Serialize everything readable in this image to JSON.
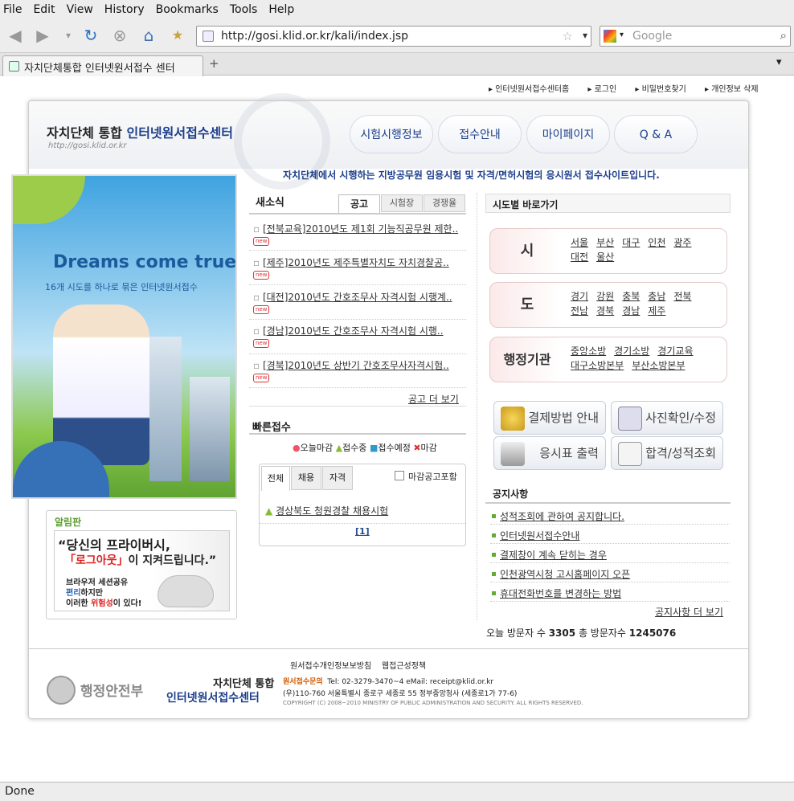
{
  "browser": {
    "menu": [
      "File",
      "Edit",
      "View",
      "History",
      "Bookmarks",
      "Tools",
      "Help"
    ],
    "url": "http://gosi.klid.or.kr/kali/index.jsp",
    "search_placeholder": "Google",
    "tab_title": "자치단체통합 인터넷원서접수 센터",
    "status": "Done"
  },
  "toplinks": [
    "인터넷원서접수센터홈",
    "로그인",
    "비밀번호찾기",
    "개인정보 삭제"
  ],
  "header": {
    "title_a": "자치단체 통합",
    "title_b": "인터넷원서접수센터",
    "url": "http://gosi.klid.or.kr",
    "nav": [
      "시험시행정보",
      "접수안내",
      "마이페이지",
      "Q & A"
    ],
    "tagline": "자치단체에서 시행하는 지방공무원 임용시험 및 자격/면허시험의 응시원서 접수사이트입니다."
  },
  "banner": {
    "headline": "Dreams come true!",
    "sub": "16개 시도를 하나로 묶은 인터넷원서접수"
  },
  "notice_board": {
    "title": "알림판",
    "quote1": "당신의 프라이버시,",
    "quote2a": "「로그아웃」",
    "quote2b": "이 지켜드립니다.",
    "body1": "브라우저 세션공유",
    "body2a": "편리",
    "body2b": "하지만",
    "body3a": "이러한 ",
    "body3b": "위험성",
    "body3c": "이 있다!"
  },
  "news": {
    "title": "새소식",
    "tabs": [
      "공고",
      "시험장",
      "경쟁율"
    ],
    "items": [
      "[전북교육]2010년도 제1회 기능직공무원 제한..",
      "[제주]2010년도 제주특별자치도 자치경찰공..",
      "[대전]2010년도 간호조무사 자격시험 시행계..",
      "[경남]2010년도 간호조무사 자격시험 시행..",
      "[경북]2010년도 상반기 간호조무사자격시험.."
    ],
    "new_label": "new",
    "more": "공고 더 보기"
  },
  "quick": {
    "title": "빠른접수",
    "legend": [
      "오늘마감",
      "접수중",
      "접수예정",
      "마감"
    ],
    "tabs": [
      "전체",
      "채용",
      "자격"
    ],
    "checkbox": "마감공고포함",
    "item": "경상북도 청원경찰 채용시험",
    "page": "[1]"
  },
  "regions": {
    "title": "시도별 바로가기",
    "groups": [
      {
        "label": "시",
        "cities": [
          "서울",
          "부산",
          "대구",
          "인천",
          "광주",
          "대전",
          "울산"
        ]
      },
      {
        "label": "도",
        "cities": [
          "경기",
          "강원",
          "충북",
          "충남",
          "전북",
          "전남",
          "경북",
          "경남",
          "제주"
        ]
      },
      {
        "label": "행정기관",
        "cities": [
          "중앙소방",
          "경기소방",
          "경기교육",
          "대구소방본부",
          "부산소방본부"
        ]
      }
    ]
  },
  "quick_buttons": [
    "결제방법 안내",
    "사진확인/수정",
    "응시표 출력",
    "합격/성적조회"
  ],
  "notices": {
    "title": "공지사항",
    "items": [
      "성적조회에 관하여 공지합니다.",
      "인터넷원서접수안내",
      "결제창이 계속 닫히는 경우",
      "인천광역시청 고시홈페이지 오픈",
      "휴대전화번호를 변경하는 방법"
    ],
    "more": "공지사항 더 보기"
  },
  "visitors": {
    "today_label": "오늘 방문자 수",
    "today": "3305",
    "total_label": "총 방문자수",
    "total": "1245076"
  },
  "footer": {
    "links": [
      "원서접수개인정보보방침",
      "웹접근성정책"
    ],
    "ministry": "행정안전부",
    "title_a": "자치단체 통합",
    "title_b": "인터넷원서접수센터",
    "contact_label": "원서접수문의",
    "contact": "Tel: 02-3279-3470~4  eMail: receipt@klid.or.kr",
    "address": "(우)110-760 서울특별시 종로구 세종로 55 정부중앙청사 (세종로1가 77-6)",
    "copyright": "COPYRIGHT (C) 2008~2010 MINISTRY OF PUBLIC ADMINISTRATION AND SECURITY. ALL RIGHTS RESERVED."
  }
}
